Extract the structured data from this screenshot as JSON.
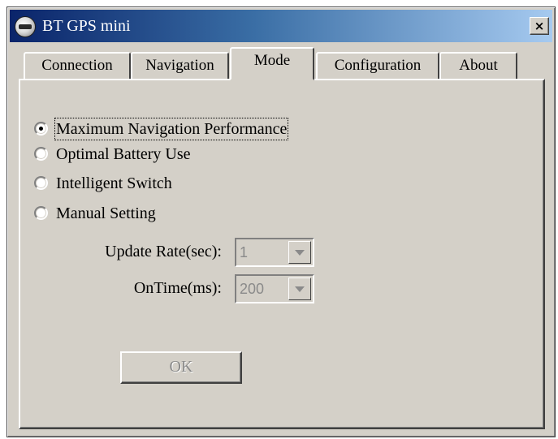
{
  "window": {
    "title": "BT GPS mini",
    "close_label": "×"
  },
  "tabs": [
    {
      "label": "Connection",
      "active": false
    },
    {
      "label": "Navigation",
      "active": false
    },
    {
      "label": "Mode",
      "active": true
    },
    {
      "label": "Configuration",
      "active": false
    },
    {
      "label": "About",
      "active": false
    }
  ],
  "mode": {
    "options": [
      {
        "label": "Maximum Navigation Performance",
        "selected": true
      },
      {
        "label": "Optimal Battery Use",
        "selected": false
      },
      {
        "label": "Intelligent Switch",
        "selected": false
      },
      {
        "label": "Manual Setting",
        "selected": false
      }
    ],
    "update_rate": {
      "label": "Update Rate(sec):",
      "value": "1",
      "enabled": false
    },
    "on_time": {
      "label": "OnTime(ms):",
      "value": "200",
      "enabled": false
    },
    "ok_label": "OK"
  },
  "icons": {
    "app": "gps-receiver-icon",
    "dropdown": "chevron-down-icon"
  }
}
